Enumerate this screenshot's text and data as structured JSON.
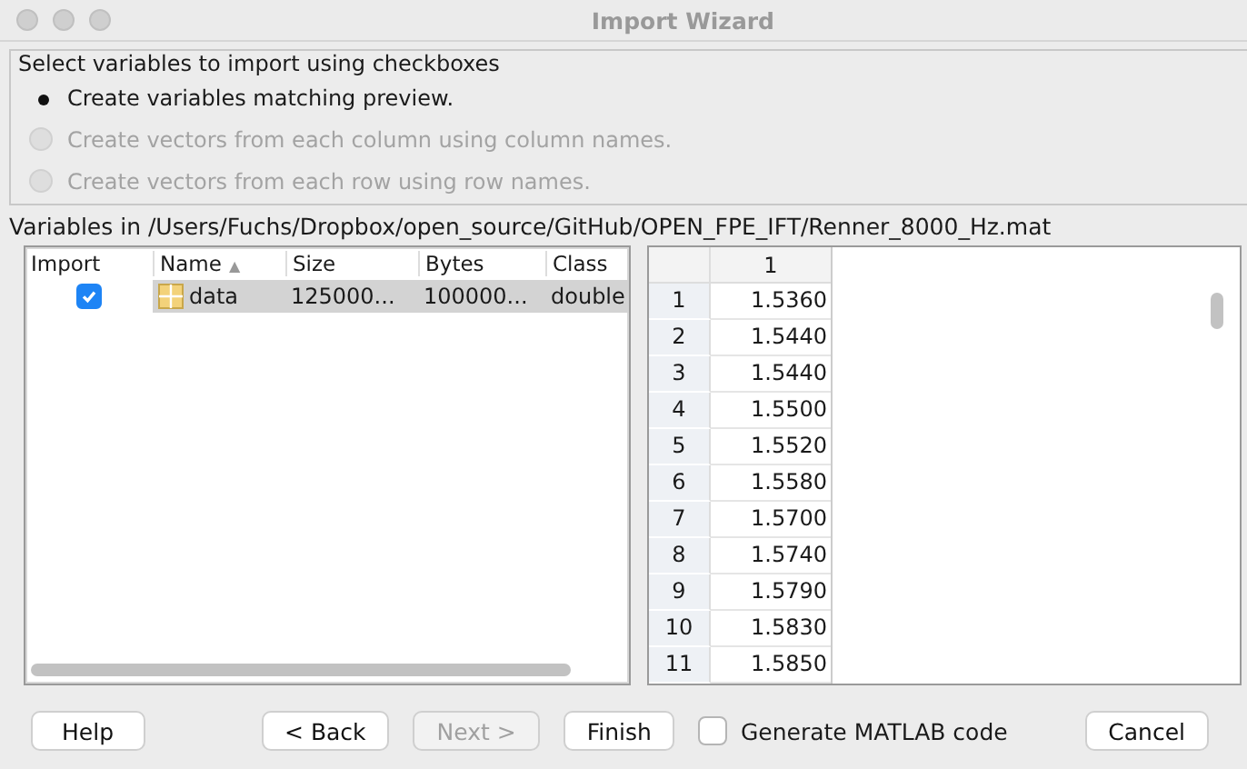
{
  "window": {
    "title": "Import Wizard"
  },
  "options": {
    "legend": "Select variables to import using checkboxes",
    "radios": [
      {
        "label": "Create variables matching preview.",
        "selected": true,
        "disabled": false
      },
      {
        "label": "Create vectors from each column using column names.",
        "selected": false,
        "disabled": true
      },
      {
        "label": "Create vectors from each row using row names.",
        "selected": false,
        "disabled": true
      }
    ]
  },
  "variables_label": "Variables in /Users/Fuchs/Dropbox/open_source/GitHub/OPEN_FPE_IFT/Renner_8000_Hz.mat",
  "variables": {
    "columns": [
      {
        "label": "Import"
      },
      {
        "label": "Name",
        "sort": "▲"
      },
      {
        "label": "Size"
      },
      {
        "label": "Bytes"
      },
      {
        "label": "Class"
      }
    ],
    "rows": [
      {
        "checked": true,
        "selected": true,
        "name": "data",
        "size": "125000...",
        "bytes": "100000...",
        "class": "double"
      }
    ]
  },
  "preview": {
    "column": "1",
    "rows": [
      {
        "index": "1",
        "value": "1.5360"
      },
      {
        "index": "2",
        "value": "1.5440"
      },
      {
        "index": "3",
        "value": "1.5440"
      },
      {
        "index": "4",
        "value": "1.5500"
      },
      {
        "index": "5",
        "value": "1.5520"
      },
      {
        "index": "6",
        "value": "1.5580"
      },
      {
        "index": "7",
        "value": "1.5700"
      },
      {
        "index": "8",
        "value": "1.5740"
      },
      {
        "index": "9",
        "value": "1.5790"
      },
      {
        "index": "10",
        "value": "1.5830"
      },
      {
        "index": "11",
        "value": "1.5850"
      }
    ]
  },
  "buttons": [
    {
      "kind": "button",
      "label": "Help",
      "disabled": false
    },
    {
      "kind": "spacer"
    },
    {
      "kind": "button",
      "label": "< Back",
      "disabled": false
    },
    {
      "kind": "button",
      "label": "Next >",
      "disabled": true
    },
    {
      "kind": "button",
      "label": "Finish",
      "disabled": false
    },
    {
      "kind": "checkbox",
      "label": "Generate MATLAB code",
      "checked": false
    },
    {
      "kind": "button",
      "label": "Cancel",
      "disabled": false
    }
  ]
}
